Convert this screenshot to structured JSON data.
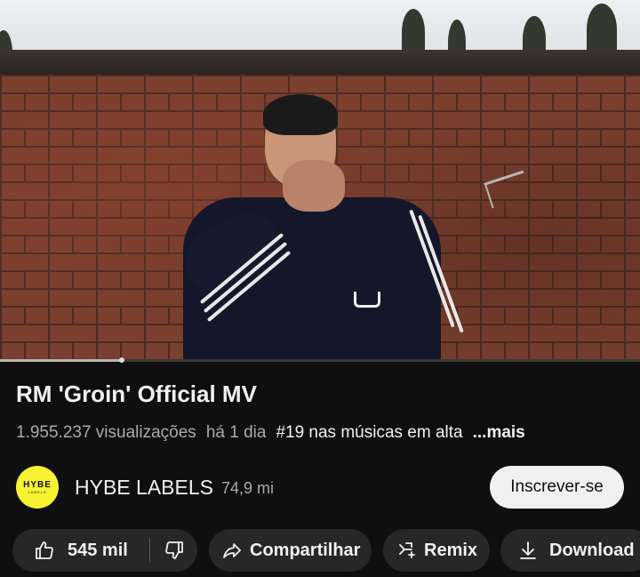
{
  "video": {
    "progress_fraction": 0.19
  },
  "title": "RM 'Groin' Official MV",
  "meta": {
    "views": "1.955.237 visualizações",
    "age": "há 1 dia",
    "trending": "#19 nas músicas em alta",
    "more": "...mais"
  },
  "channel": {
    "avatar_text": "HYBE",
    "avatar_subtext": "LABELS",
    "name": "HYBE LABELS",
    "subscribers": "74,9 mi",
    "subscribe_label": "Inscrever-se"
  },
  "actions": {
    "like_count": "545 mil",
    "share_label": "Compartilhar",
    "remix_label": "Remix",
    "download_label": "Download",
    "icons": [
      "thumbs-up-icon",
      "thumbs-down-icon",
      "share-icon",
      "remix-icon",
      "download-icon"
    ]
  },
  "colors": {
    "background": "#0f0f0f",
    "chip": "#272727",
    "subscribe_bg": "#f1f1f1",
    "avatar_bg": "#f7f232"
  }
}
